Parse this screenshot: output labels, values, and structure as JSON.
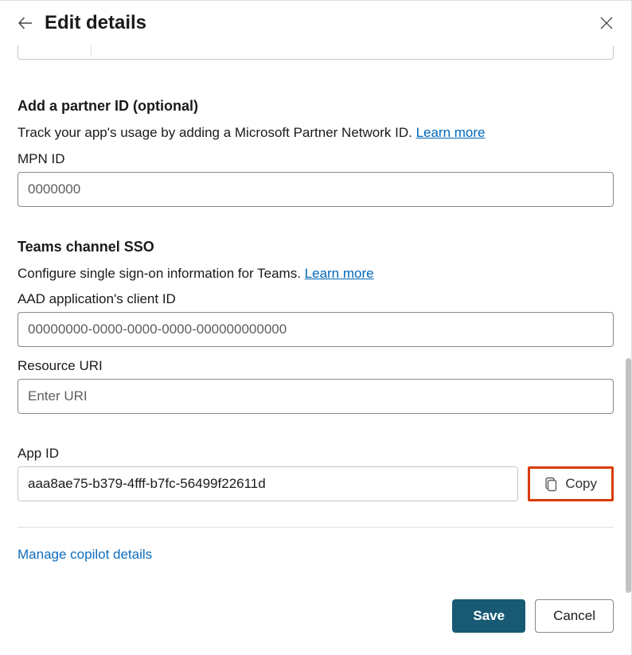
{
  "header": {
    "title": "Edit details"
  },
  "partner_section": {
    "heading": "Add a partner ID (optional)",
    "description": "Track your app's usage by adding a Microsoft Partner Network ID. ",
    "learn_more": "Learn more",
    "mpn_label": "MPN ID",
    "mpn_placeholder": "0000000"
  },
  "sso_section": {
    "heading": "Teams channel SSO",
    "description": "Configure single sign-on information for Teams. ",
    "learn_more": "Learn more",
    "aad_label": "AAD application's client ID",
    "aad_placeholder": "00000000-0000-0000-0000-000000000000",
    "resource_label": "Resource URI",
    "resource_placeholder": "Enter URI"
  },
  "appid_section": {
    "label": "App ID",
    "value": "aaa8ae75-b379-4fff-b7fc-56499f22611d",
    "copy_label": "Copy"
  },
  "manage_link": "Manage copilot details",
  "footer": {
    "save": "Save",
    "cancel": "Cancel"
  }
}
